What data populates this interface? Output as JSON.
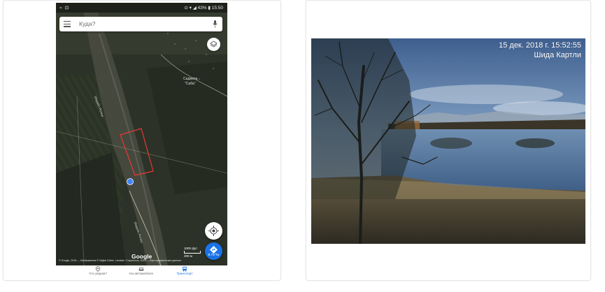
{
  "phone": {
    "status_left": "⌁ ⊡",
    "status_right": "⊙ ▾ ◢ 43% ▮ 15:50",
    "search_placeholder": "Куда?",
    "map_labels": {
      "road_left": "Шидабо Ротеш",
      "village": "Саджота\n\"Саба\"",
      "road_bottom": "Шидабо Ротеш"
    },
    "route_button_label": "В ПУТЬ",
    "scale_top": "1000 фут",
    "scale_bottom": "200 м",
    "google": "Google",
    "copyright": "© Google, 2018 — Изображения © Digital Globe, Landsat / Copernicus, 2018 — Картографические данные",
    "nav": [
      {
        "label": "Что рядом?",
        "icon": "pin-icon",
        "active": false
      },
      {
        "label": "На автомобиле",
        "icon": "car-icon",
        "active": false
      },
      {
        "label": "Транспорт",
        "icon": "bus-icon",
        "active": true
      }
    ]
  },
  "photo": {
    "timestamp_line1": "15 дек. 2018 г. 15:52:55",
    "timestamp_line2": "Шида Картли"
  },
  "colors": {
    "accent": "#1a73e8",
    "highlight_polygon": "#e53935",
    "location_dot": "#4285f4"
  }
}
